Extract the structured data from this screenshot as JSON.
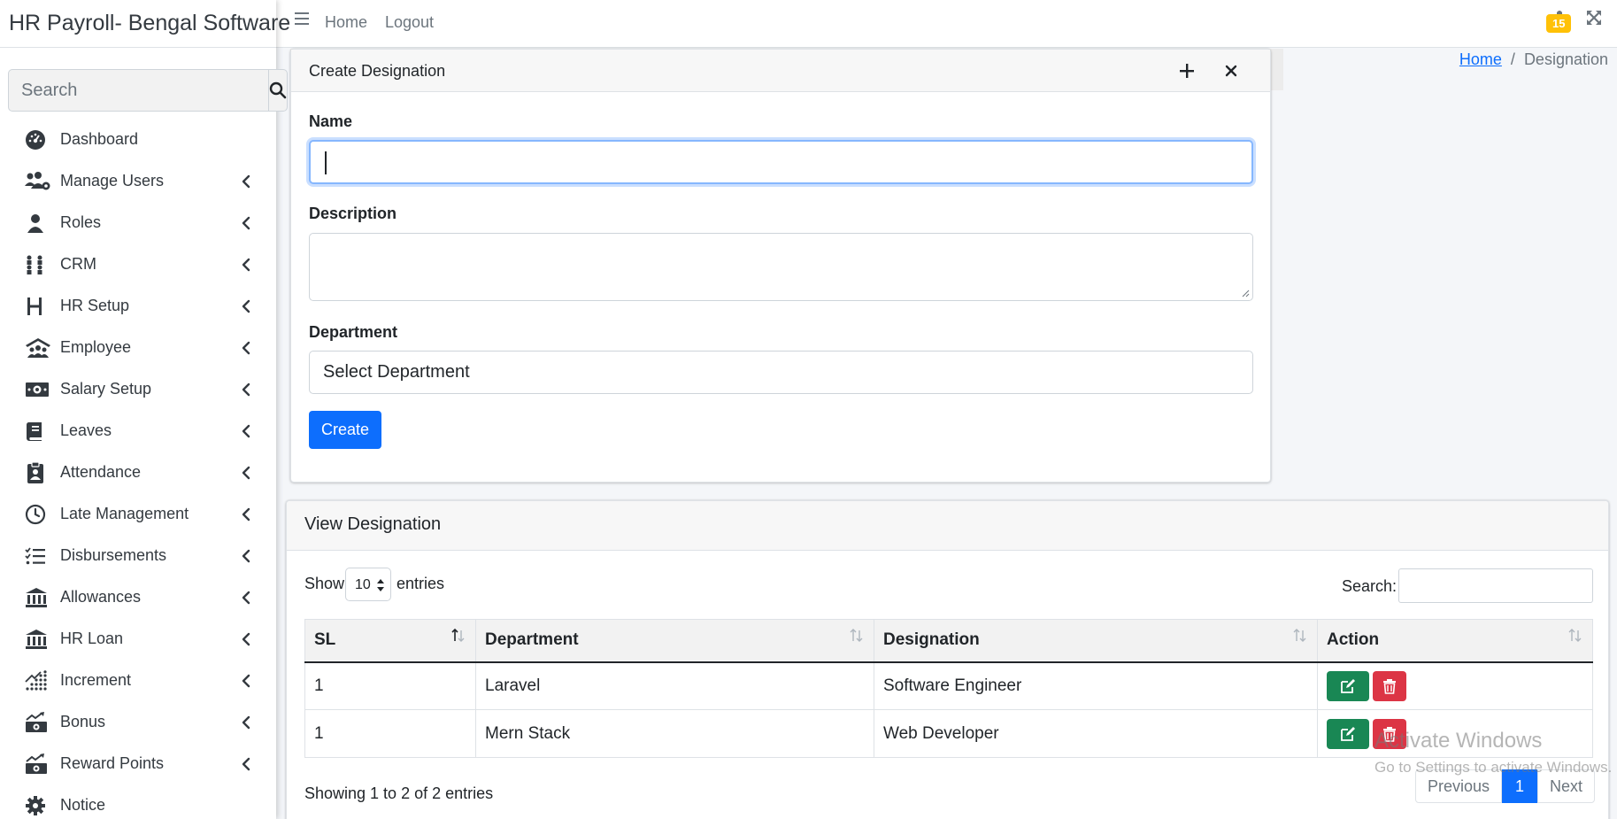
{
  "app": {
    "brand": "HR Payroll- Bengal Software"
  },
  "sidebar": {
    "search_placeholder": "Search",
    "items": [
      {
        "label": "Dashboard",
        "icon": "dashboard-gauge-icon",
        "has_children": false
      },
      {
        "label": "Manage Users",
        "icon": "users-cog-icon",
        "has_children": true
      },
      {
        "label": "Roles",
        "icon": "user-icon",
        "has_children": true
      },
      {
        "label": "CRM",
        "icon": "crm-people-icon",
        "has_children": true
      },
      {
        "label": "HR Setup",
        "icon": "h-letter-icon",
        "has_children": true
      },
      {
        "label": "Employee",
        "icon": "building-people-icon",
        "has_children": true
      },
      {
        "label": "Salary Setup",
        "icon": "money-bill-icon",
        "has_children": true
      },
      {
        "label": "Leaves",
        "icon": "book-icon",
        "has_children": true
      },
      {
        "label": "Attendance",
        "icon": "clipboard-user-icon",
        "has_children": true
      },
      {
        "label": "Late Management",
        "icon": "clock-icon",
        "has_children": true
      },
      {
        "label": "Disbursements",
        "icon": "list-check-icon",
        "has_children": true
      },
      {
        "label": "Allowances",
        "icon": "bank-icon",
        "has_children": true
      },
      {
        "label": "HR Loan",
        "icon": "bank-icon",
        "has_children": true
      },
      {
        "label": "Increment",
        "icon": "chart-dots-icon",
        "has_children": true
      },
      {
        "label": "Bonus",
        "icon": "money-chart-icon",
        "has_children": true
      },
      {
        "label": "Reward Points",
        "icon": "money-chart-icon",
        "has_children": true
      },
      {
        "label": "Notice",
        "icon": "gear-icon",
        "has_children": false
      }
    ]
  },
  "topbar": {
    "home": "Home",
    "logout": "Logout",
    "notification_count": "15"
  },
  "breadcrumb": {
    "home": "Home",
    "separator": "/",
    "current": "Designation"
  },
  "create_card": {
    "title": "Create Designation",
    "name_label": "Name",
    "name_value": "",
    "description_label": "Description",
    "description_value": "",
    "department_label": "Department",
    "department_selected": "Select Department",
    "create_button": "Create"
  },
  "view_card": {
    "title": "View Designation",
    "show_label": "Show",
    "entries_label": "entries",
    "page_length": "10",
    "search_label": "Search:",
    "columns": [
      "SL",
      "Department",
      "Designation",
      "Action"
    ],
    "rows": [
      {
        "sl": "1",
        "department": "Laravel",
        "designation": "Software Engineer"
      },
      {
        "sl": "1",
        "department": "Mern Stack",
        "designation": "Web Developer"
      }
    ],
    "info": "Showing 1 to 2 of 2 entries",
    "pagination": {
      "previous": "Previous",
      "page": "1",
      "next": "Next"
    }
  },
  "watermark": {
    "title": "Activate Windows",
    "subtitle": "Go to Settings to activate Windows."
  },
  "colors": {
    "primary": "#0d6efd",
    "success": "#198754",
    "danger": "#dc3545",
    "warning": "#ffc107"
  }
}
